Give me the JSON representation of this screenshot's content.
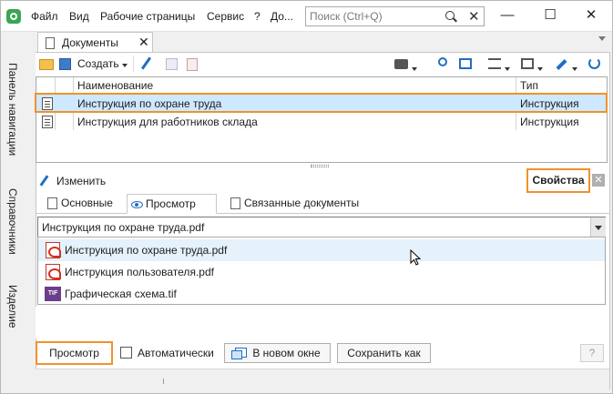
{
  "menu": [
    "Файл",
    "Вид",
    "Рабочие страницы",
    "Сервис",
    "?",
    "До..."
  ],
  "search": {
    "placeholder": "Поиск (Ctrl+Q)"
  },
  "window_controls": {
    "minimize": "—",
    "maximize": "☐",
    "close": "✕"
  },
  "sidebar": {
    "tabs": [
      "Панель навигации",
      "Справочники",
      "Изделие"
    ]
  },
  "doc_tab": {
    "label": "Документы",
    "close": "✕"
  },
  "toolbar": {
    "create_label": "Создать"
  },
  "table": {
    "columns": [
      "Наименование",
      "Тип"
    ],
    "rows": [
      {
        "name": "Инструкция по охране труда",
        "type": "Инструкция",
        "selected": true
      },
      {
        "name": "Инструкция для работников склада",
        "type": "Инструкция",
        "selected": false
      }
    ]
  },
  "properties": {
    "edit_label": "Изменить",
    "props_button": "Свойства",
    "close": "✕",
    "tabs": [
      "Основные",
      "Просмотр",
      "Связанные документы"
    ],
    "active_tab": "Просмотр",
    "combo_value": "Инструкция по охране труда.pdf",
    "files": [
      {
        "name": "Инструкция по охране труда.pdf",
        "icon": "pdf-icon"
      },
      {
        "name": "Инструкция пользователя.pdf",
        "icon": "pdf-icon"
      },
      {
        "name": "Графическая схема.tif",
        "icon": "tif-icon"
      }
    ]
  },
  "buttons": {
    "preview": "Просмотр",
    "auto": "Автоматически",
    "new_window": "В новом окне",
    "save_as": "Сохранить как",
    "help": "?"
  },
  "colors": {
    "highlight": "#f0922b",
    "selection": "#cde8ff",
    "accent": "#1e6fc4"
  }
}
